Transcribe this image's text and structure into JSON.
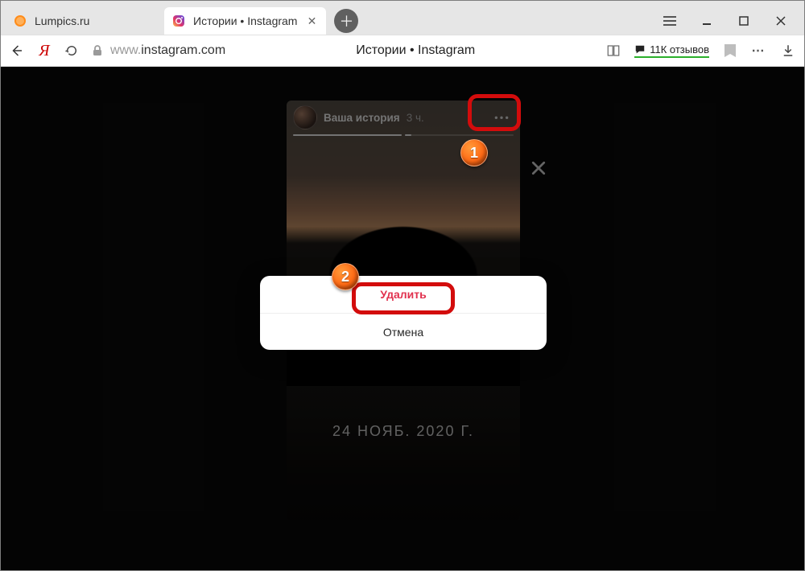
{
  "browser": {
    "tabs": [
      {
        "title": "Lumpics.ru",
        "favicon": "orange-circle",
        "active": false
      },
      {
        "title": "Истории • Instagram",
        "favicon": "instagram",
        "active": true
      }
    ],
    "url": {
      "scheme_host_muted": "www.",
      "host": "instagram.com"
    },
    "page_title_center": "Истории • Instagram",
    "reviews_label": "11К отзывов"
  },
  "story": {
    "user_label": "Ваша история",
    "time_label": "3 ч.",
    "caption": "24 НОЯБ. 2020 Г.",
    "segments": 2,
    "segment_progress": [
      1.0,
      0.06
    ]
  },
  "dialog": {
    "delete_label": "Удалить",
    "cancel_label": "Отмена"
  },
  "callouts": {
    "b1": "1",
    "b2": "2"
  }
}
